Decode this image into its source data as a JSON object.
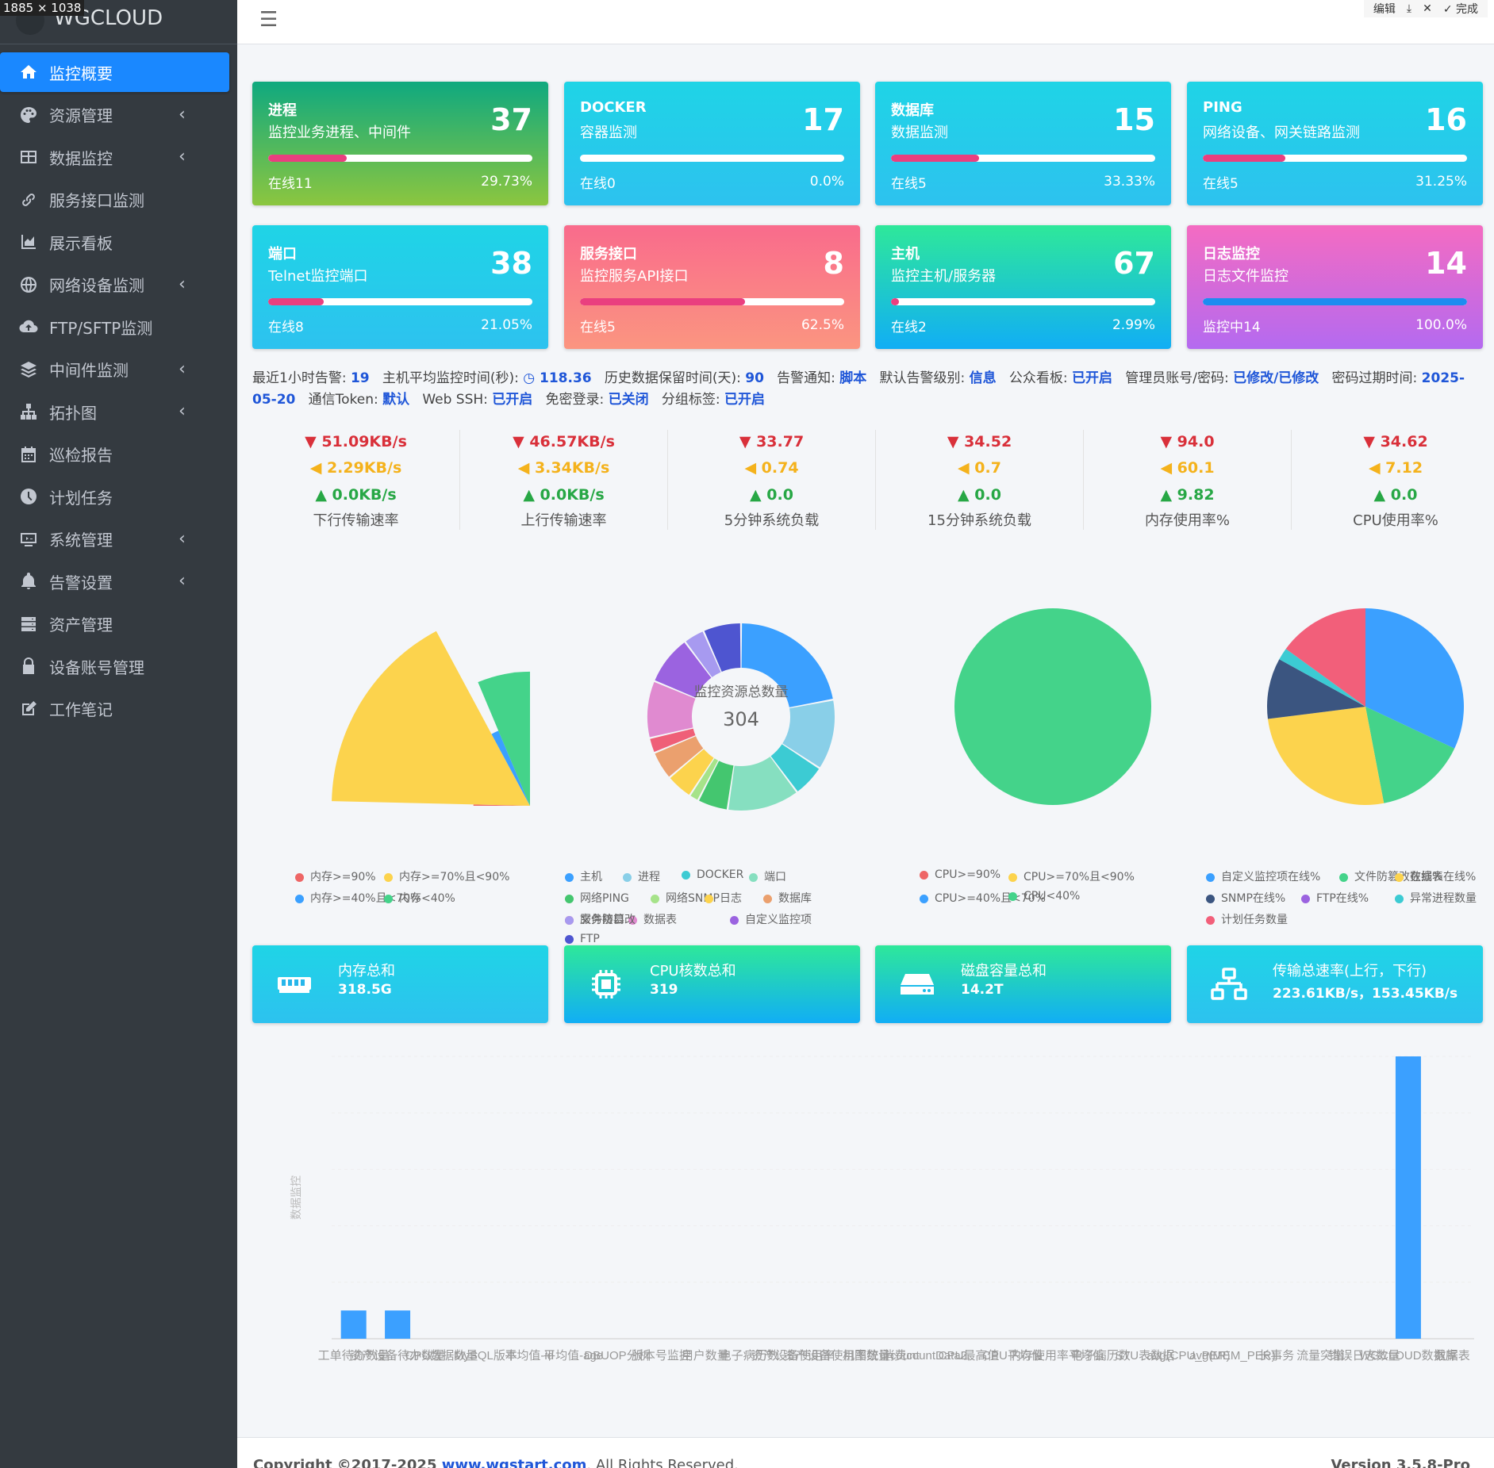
{
  "badge": "1885 × 1038",
  "editbar": {
    "edit": "编辑",
    "done": "✓ 完成"
  },
  "brand": "WGCLOUD",
  "nav": [
    {
      "label": "监控概要",
      "icon": "home-icon",
      "arrow": false,
      "active": true
    },
    {
      "label": "资源管理",
      "icon": "palette-icon",
      "arrow": true
    },
    {
      "label": "数据监控",
      "icon": "table-icon",
      "arrow": true
    },
    {
      "label": "服务接口监测",
      "icon": "link-icon",
      "arrow": false
    },
    {
      "label": "展示看板",
      "icon": "area-chart-icon",
      "arrow": false
    },
    {
      "label": "网络设备监测",
      "icon": "globe-icon",
      "arrow": true
    },
    {
      "label": "FTP/SFTP监测",
      "icon": "cloud-upload-icon",
      "arrow": false
    },
    {
      "label": "中间件监测",
      "icon": "layers-icon",
      "arrow": true
    },
    {
      "label": "拓扑图",
      "icon": "sitemap-icon",
      "arrow": true
    },
    {
      "label": "巡检报告",
      "icon": "calendar-icon",
      "arrow": false
    },
    {
      "label": "计划任务",
      "icon": "clock-icon",
      "arrow": false
    },
    {
      "label": "系统管理",
      "icon": "monitor-icon",
      "arrow": true
    },
    {
      "label": "告警设置",
      "icon": "bell-icon",
      "arrow": true
    },
    {
      "label": "资产管理",
      "icon": "server-icon",
      "arrow": false
    },
    {
      "label": "设备账号管理",
      "icon": "lock-icon",
      "arrow": false
    },
    {
      "label": "工作笔记",
      "icon": "edit-icon",
      "arrow": false
    }
  ],
  "cards": [
    {
      "title": "进程",
      "sub": "监控业务进程、中间件",
      "count": "37",
      "online": "在线11",
      "pct": "29.73%",
      "fill": 0.2973,
      "bg": "linear-gradient(180deg,#0fa97f 0%,#8cc63f 100%)"
    },
    {
      "title": "DOCKER",
      "sub": "容器监测",
      "count": "17",
      "online": "在线0",
      "pct": "0.0%",
      "fill": 0,
      "bg": "linear-gradient(180deg,#1fd4e6 0%,#2dc2ef 100%)"
    },
    {
      "title": "数据库",
      "sub": "数据监测",
      "count": "15",
      "online": "在线5",
      "pct": "33.33%",
      "fill": 0.3333,
      "bg": "linear-gradient(180deg,#1fd4e6 0%,#2dc2ef 100%)"
    },
    {
      "title": "PING",
      "sub": "网络设备、网关链路监测",
      "count": "16",
      "online": "在线5",
      "pct": "31.25%",
      "fill": 0.3125,
      "bg": "linear-gradient(180deg,#1fd4e6 0%,#2dc2ef 100%)"
    },
    {
      "title": "端口",
      "sub": "Telnet监控端口",
      "count": "38",
      "online": "在线8",
      "pct": "21.05%",
      "fill": 0.2105,
      "bg": "linear-gradient(180deg,#1fd4e6 0%,#2dc2ef 100%)"
    },
    {
      "title": "服务接口",
      "sub": "监控服务API接口",
      "count": "8",
      "online": "在线5",
      "pct": "62.5%",
      "fill": 0.625,
      "bg": "linear-gradient(180deg,#f96b8c 0%,#fb9580 100%)"
    },
    {
      "title": "主机",
      "sub": "监控主机/服务器",
      "count": "67",
      "online": "在线2",
      "pct": "2.99%",
      "fill": 0.0299,
      "bg": "linear-gradient(180deg,#2ee89a 0%,#11aef5 100%)"
    },
    {
      "title": "日志监控",
      "sub": "日志文件监控",
      "count": "14",
      "online": "监控中14",
      "pct": "100.0%",
      "fill": 1,
      "bg": "linear-gradient(180deg,#f46bc2 0%,#b46af0 100%)",
      "fillColor": "#1e8cf0"
    }
  ],
  "info": {
    "alarm_label": "最近1小时告警:",
    "alarm_val": "19",
    "avg_label": "主机平均监控时间(秒):",
    "avg_val": "118.36",
    "keep_label": "历史数据保留时间(天):",
    "keep_val": "90",
    "notify_label": "告警通知:",
    "notify_val": "脚本",
    "level_label": "默认告警级别:",
    "level_val": "信息",
    "public_label": "公众看板:",
    "public_val": "已开启",
    "admin_label": "管理员账号/密码:",
    "admin_val": "已修改/已修改",
    "expire_label": "密码过期时间:",
    "expire_val": "2025-05-20",
    "token_label": "通信Token:",
    "token_val": "默认",
    "ssh_label": "Web SSH:",
    "ssh_val": "已开启",
    "free_label": "免密登录:",
    "free_val": "已关闭",
    "group_label": "分组标签:",
    "group_val": "已开启"
  },
  "metrics": [
    {
      "max": "51.09KB/s",
      "avg": "2.29KB/s",
      "min": "0.0KB/s",
      "label": "下行传输速率"
    },
    {
      "max": "46.57KB/s",
      "avg": "3.34KB/s",
      "min": "0.0KB/s",
      "label": "上行传输速率"
    },
    {
      "max": "33.77",
      "avg": "0.74",
      "min": "0.0",
      "label": "5分钟系统负载"
    },
    {
      "max": "34.52",
      "avg": "0.7",
      "min": "0.0",
      "label": "15分钟系统负载"
    },
    {
      "max": "94.0",
      "avg": "60.1",
      "min": "9.82",
      "label": "内存使用率%"
    },
    {
      "max": "34.62",
      "avg": "7.12",
      "min": "0.0",
      "label": "CPU使用率%"
    }
  ],
  "chart_data": [
    {
      "type": "pie",
      "slices": [
        {
          "name": "内存>=90%",
          "value": 1,
          "color": "#ee6666"
        },
        {
          "name": "内存>=70%且<90%",
          "value": 45,
          "color": "#fcd34d"
        },
        {
          "name": "内存>=40%且<70%",
          "value": 4,
          "color": "#3ba0ff"
        },
        {
          "name": "内存<40%",
          "value": 17,
          "color": "#44d38a"
        }
      ]
    },
    {
      "type": "donut",
      "title": "监控资源总数量",
      "total": "304",
      "slices": [
        {
          "name": "主机",
          "value": 67,
          "color": "#3ba0ff"
        },
        {
          "name": "进程",
          "value": 37,
          "color": "#89cfe8"
        },
        {
          "name": "DOCKER",
          "value": 17,
          "color": "#3ccbd3"
        },
        {
          "name": "端口",
          "value": 38,
          "color": "#86dfc0"
        },
        {
          "name": "网络PING",
          "value": 16,
          "color": "#44c66f"
        },
        {
          "name": "网络SNMP",
          "value": 5,
          "color": "#a6e38a"
        },
        {
          "name": "日志",
          "value": 14,
          "color": "#fcd34d"
        },
        {
          "name": "数据库",
          "value": 15,
          "color": "#eba06e"
        },
        {
          "name": "服务接口",
          "value": 8,
          "color": "#ef5f78"
        },
        {
          "name": "数据表",
          "value": 30,
          "color": "#e08ad0"
        },
        {
          "name": "自定义监控项",
          "value": 26,
          "color": "#9b63e0"
        },
        {
          "name": "文件防篡改",
          "value": 11,
          "color": "#a79af0"
        },
        {
          "name": "FTP",
          "value": 20,
          "color": "#4e55d0"
        }
      ]
    },
    {
      "type": "pie",
      "slices": [
        {
          "name": "CPU>=90%",
          "value": 0,
          "color": "#ee6666"
        },
        {
          "name": "CPU>=70%且<90%",
          "value": 0,
          "color": "#fcd34d"
        },
        {
          "name": "CPU>=40%且<70%",
          "value": 0,
          "color": "#3ba0ff"
        },
        {
          "name": "CPU<40%",
          "value": 67,
          "color": "#44d38a"
        }
      ]
    },
    {
      "type": "pie",
      "slices": [
        {
          "name": "自定义监控项在线%",
          "value": 32,
          "color": "#3ba0ff"
        },
        {
          "name": "文件防篡改在线%",
          "value": 15,
          "color": "#44d38a"
        },
        {
          "name": "数据表在线%",
          "value": 26,
          "color": "#fcd34d"
        },
        {
          "name": "SNMP在线%",
          "value": 10,
          "color": "#3b5580"
        },
        {
          "name": "FTP在线%",
          "value": 0,
          "color": "#9b63e0"
        },
        {
          "name": "异常进程数量",
          "value": 2,
          "color": "#3ccbd3"
        },
        {
          "name": "计划任务数量",
          "value": 15,
          "color": "#f25f7a"
        }
      ]
    },
    {
      "type": "bar",
      "ylabel": "数据监控",
      "ylim": [
        0,
        100
      ],
      "categories": [
        "工单待办数量",
        "资产设备待办数量",
        "CPU数据数量",
        "MySQL版本",
        "平均值-id",
        "平均值-age",
        "DBUOP分析",
        "版本号监控",
        "用户数量",
        "电子病历数",
        "资产设备使用率",
        "资产设备使用率统计",
        "机图数量count",
        "消费countData2",
        "CPU最高值",
        "CPU平均值",
        "内存使用率平均值",
        "电子病历数",
        "STU表数据",
        "avg(CPU_PER)",
        "avg(MEM_PER)",
        "长事务",
        "流量突增",
        "错误日志数量",
        "WGCLOUD数据库",
        "数据表"
      ],
      "values": [
        10,
        10,
        0,
        0,
        0,
        0,
        0,
        0,
        0,
        0,
        0,
        0,
        0,
        0,
        0,
        0,
        0,
        0,
        0,
        0,
        0,
        0,
        0,
        0,
        100,
        0
      ]
    }
  ],
  "stats": [
    {
      "title": "内存总和",
      "value": "318.5G",
      "icon": "memory-icon",
      "bg": "linear-gradient(180deg,#1fd4e6,#2dc2ef)"
    },
    {
      "title": "CPU核数总和",
      "value": "319",
      "icon": "cpu-icon",
      "bg": "linear-gradient(180deg,#2ee89a,#11aef5)"
    },
    {
      "title": "磁盘容量总和",
      "value": "14.2T",
      "icon": "hdd-icon",
      "bg": "linear-gradient(180deg,#2ee89a,#11aef5)"
    },
    {
      "title": "传输总速率(上行，下行)",
      "value": "223.61KB/s，153.45KB/s",
      "icon": "network-icon",
      "bg": "linear-gradient(180deg,#1fd4e6,#2dc2ef)"
    }
  ],
  "footer": {
    "copy": "Copyright ©2017-2025 ",
    "link": "www.wgstart.com",
    "rights": ". All Rights Reserved.",
    "version": "Version 3.5.8-Pro"
  }
}
